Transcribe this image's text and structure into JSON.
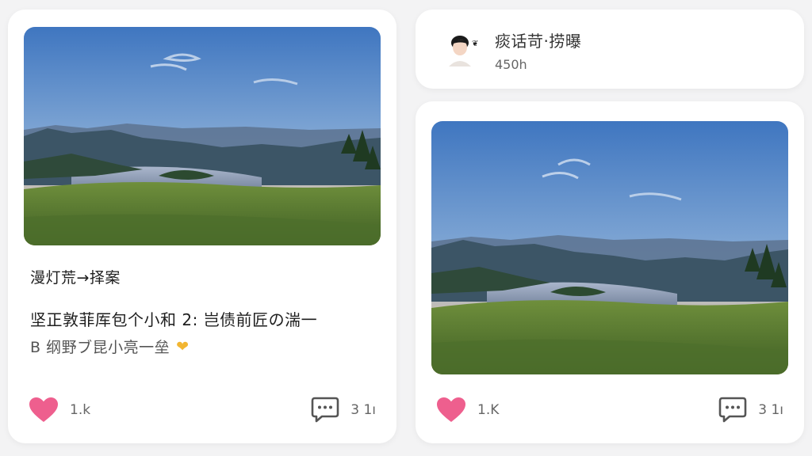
{
  "left_card": {
    "image_alt": "lake-valley-sunset-landscape",
    "title": "漫灯荒→择案",
    "body_line1": "坚正敦菲厍包个小和 2: 岂债前匠の湍一",
    "body_line2": "B 纲野ブ昆小亮一垒",
    "emoji": "heart-emoji",
    "likes": "1.k",
    "comments": "3 1ı",
    "colors": {
      "like": "#ee5f8e",
      "emoji": "#f2b632"
    }
  },
  "user_card": {
    "avatar_icon": "user-avatar-icon",
    "name": "痰话苛·捞曝",
    "meta": "450h"
  },
  "right_card": {
    "image_alt": "lake-valley-sunset-landscape",
    "likes": "1.K",
    "comments": "3 1ı",
    "colors": {
      "like": "#ee5f8e"
    }
  }
}
